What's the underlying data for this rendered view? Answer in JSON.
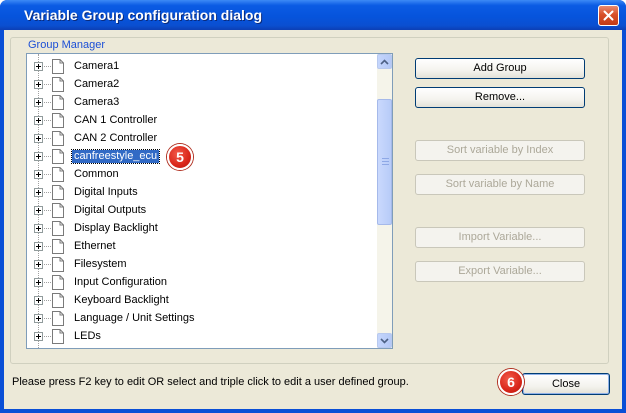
{
  "window": {
    "title": "Variable Group configuration dialog"
  },
  "group_manager": {
    "label": "Group Manager"
  },
  "tree": {
    "items": [
      {
        "label": "Camera1"
      },
      {
        "label": "Camera2"
      },
      {
        "label": "Camera3"
      },
      {
        "label": "CAN 1 Controller"
      },
      {
        "label": "CAN 2 Controller"
      },
      {
        "label": "canfreestyle_ecu",
        "selected": true
      },
      {
        "label": "Common"
      },
      {
        "label": "Digital Inputs"
      },
      {
        "label": "Digital Outputs"
      },
      {
        "label": "Display Backlight"
      },
      {
        "label": "Ethernet"
      },
      {
        "label": "Filesystem"
      },
      {
        "label": "Input Configuration"
      },
      {
        "label": "Keyboard Backlight"
      },
      {
        "label": "Language / Unit Settings"
      },
      {
        "label": "LEDs"
      }
    ]
  },
  "buttons": {
    "add_group": "Add Group",
    "remove": "Remove...",
    "sort_by_index": "Sort variable by Index",
    "sort_by_name": "Sort variable by Name",
    "import_variable": "Import Variable...",
    "export_variable": "Export Variable...",
    "close": "Close"
  },
  "hint": "Please press F2 key to edit OR select and triple click to edit a user defined group.",
  "markers": {
    "step_5": "5",
    "step_6": "6"
  },
  "colors": {
    "titlebar": "#0654dc",
    "selection": "#316ac5",
    "marker": "#d9261a",
    "dialog_bg": "#ece9d8"
  }
}
